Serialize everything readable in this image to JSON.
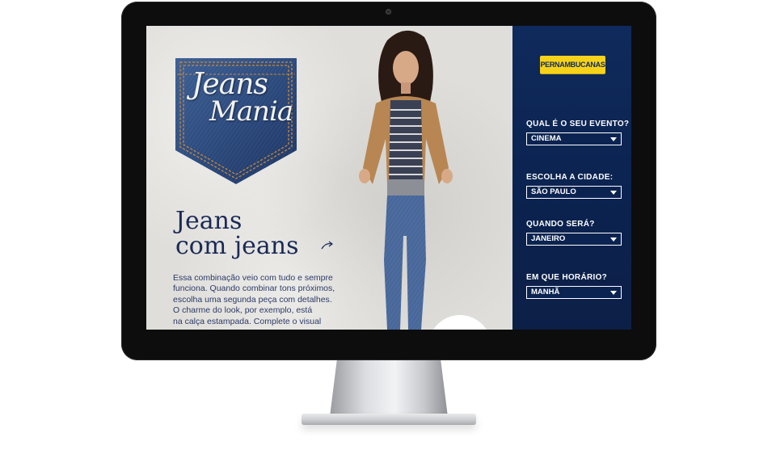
{
  "promo": {
    "logo_line1": "Jeans",
    "logo_line2": "Mania",
    "headline_line1": "Jeans",
    "headline_line2": "com jeans",
    "body_lines": [
      "Essa combinação veio com tudo e sempre",
      "funciona. Quando combinar tons próximos,",
      "escolha uma segunda peça com detalhes.",
      "O charme do look, por exemplo, está",
      "na calça estampada. Complete o visual"
    ]
  },
  "sidebar": {
    "brand": "PERNAMBUCANAS",
    "fields": [
      {
        "label": "QUAL É O SEU EVENTO?",
        "value": "CINEMA"
      },
      {
        "label": "ESCOLHA A CIDADE:",
        "value": "SÃO PAULO"
      },
      {
        "label": "QUANDO SERÁ?",
        "value": "JANEIRO"
      },
      {
        "label": "EM QUE HORÁRIO?",
        "value": "MANHÃ"
      }
    ]
  },
  "colors": {
    "sidebar_bg": "#0f2a5c",
    "brand_yellow": "#f6d21b",
    "headline": "#1b2a55"
  },
  "icons": {
    "arrow": "curved-arrow-icon",
    "select": "chevron-down-icon"
  }
}
